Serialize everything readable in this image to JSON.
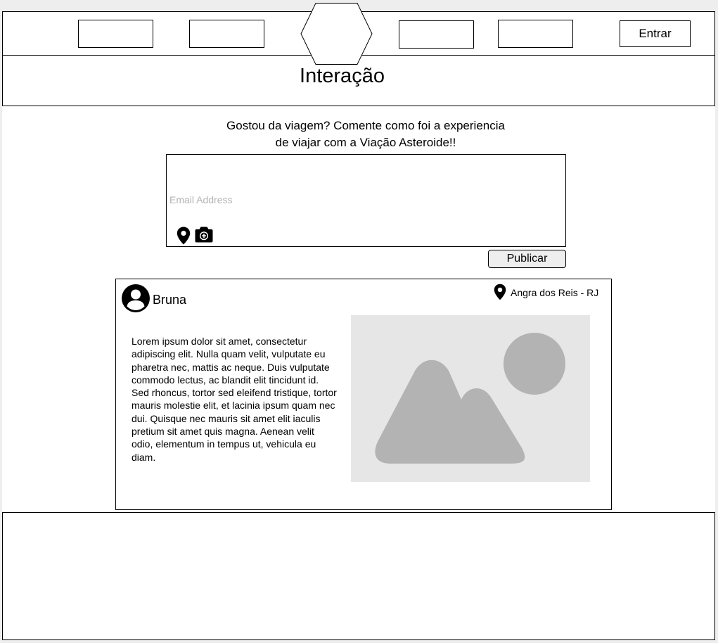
{
  "header": {
    "login_label": "Entrar",
    "page_title": "Interação"
  },
  "composer": {
    "prompt_line1": "Gostou da viagem? Comente como foi a experiencia",
    "prompt_line2": "de viajar com a Viação Asteroide!!",
    "input_placeholder": "Email Address",
    "input_value": "",
    "publish_label": "Publicar"
  },
  "post": {
    "author": "Bruna",
    "location": "Angra dos Reis - RJ",
    "text": "Lorem ipsum dolor sit amet, consectetur adipiscing elit. Nulla quam velit, vulputate eu pharetra nec, mattis ac neque. Duis vulputate commodo lectus, ac blandit elit tincidunt id. Sed rhoncus, tortor sed eleifend tristique, tortor mauris molestie elit, et lacinia ipsum quam nec dui. Quisque nec mauris sit amet elit iaculis pretium sit amet quis magna. Aenean velit odio, elementum in tempus ut, vehicula eu diam."
  },
  "icons": {
    "logo": "hexagon-logo-icon",
    "location": "map-pin-icon",
    "camera": "camera-add-icon",
    "avatar": "user-avatar-icon",
    "image": "image-placeholder-icon"
  },
  "colors": {
    "page_background": "#eeeeee",
    "border": "#000000",
    "placeholder_text": "#b3b3b3",
    "image_background": "#e6e6e6",
    "image_shapes": "#b3b3b3",
    "button_background": "#eeeeee"
  }
}
